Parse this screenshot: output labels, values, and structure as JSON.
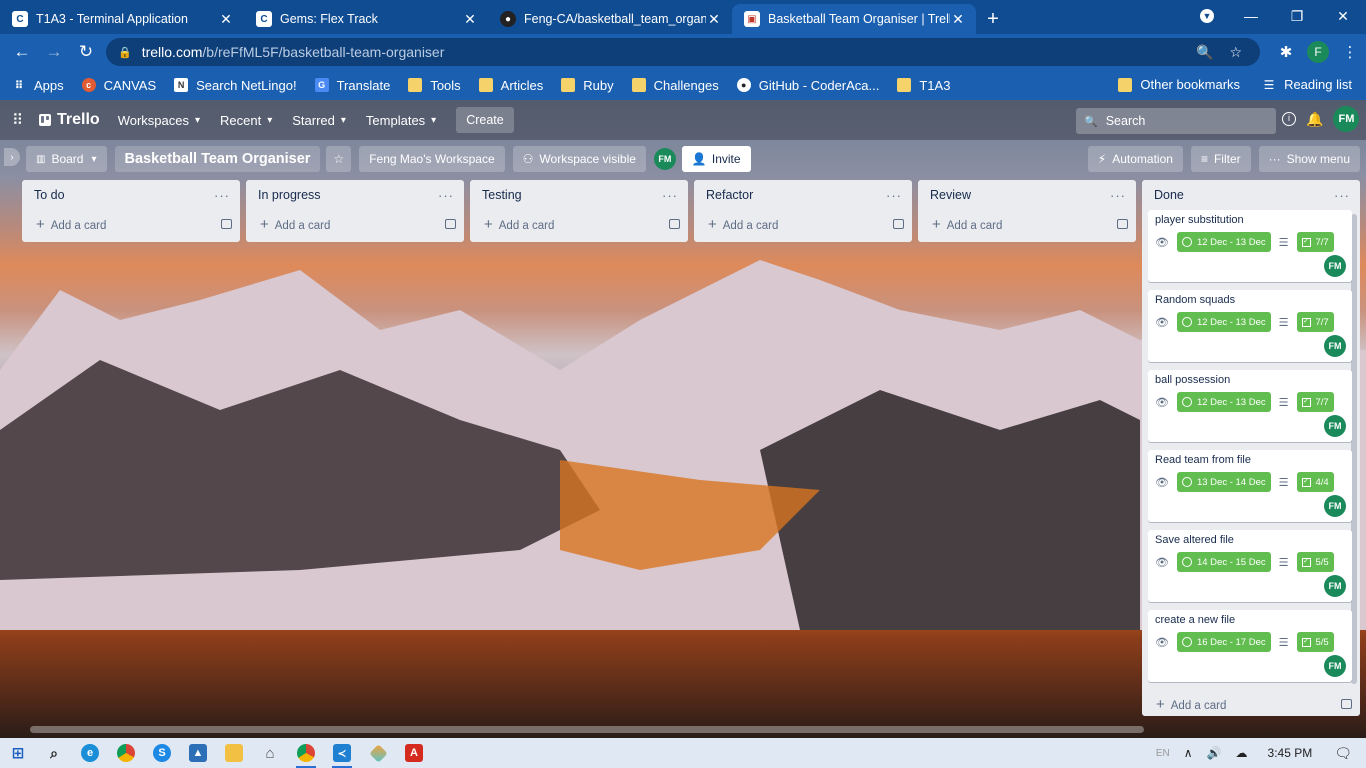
{
  "browser": {
    "tabs": [
      {
        "title": "T1A3 - Terminal Application",
        "icon": "canvas-icon",
        "active": false
      },
      {
        "title": "Gems: Flex Track",
        "icon": "canvas-icon",
        "active": false
      },
      {
        "title": "Feng-CA/basketball_team_organiser",
        "icon": "github-icon",
        "active": false
      },
      {
        "title": "Basketball Team Organiser | Trello",
        "icon": "trello-icon",
        "active": true
      }
    ],
    "url_host": "trello.com",
    "url_path": "/b/reFfML5F/basketball-team-organiser",
    "profile_initial": "F",
    "bookmarks": [
      {
        "label": "Apps",
        "icon": "apps-grid-icon"
      },
      {
        "label": "CANVAS",
        "icon": "canvas-icon"
      },
      {
        "label": "Search NetLingo!",
        "icon": "netlingo-icon"
      },
      {
        "label": "Translate",
        "icon": "translate-icon"
      },
      {
        "label": "Tools",
        "icon": "folder-icon"
      },
      {
        "label": "Articles",
        "icon": "folder-icon"
      },
      {
        "label": "Ruby",
        "icon": "folder-icon"
      },
      {
        "label": "Challenges",
        "icon": "folder-icon"
      },
      {
        "label": "GitHub - CoderAca...",
        "icon": "github-icon"
      },
      {
        "label": "T1A3",
        "icon": "folder-icon"
      }
    ],
    "other_bookmarks": "Other bookmarks",
    "reading_list": "Reading list"
  },
  "trello": {
    "logo": "Trello",
    "nav": [
      "Workspaces",
      "Recent",
      "Starred",
      "Templates"
    ],
    "create": "Create",
    "search_placeholder": "Search",
    "user_initials": "FM",
    "board": {
      "view": "Board",
      "title": "Basketball Team Organiser",
      "workspace": "Feng Mao's Workspace",
      "visibility": "Workspace visible",
      "invite": "Invite",
      "automation": "Automation",
      "filter": "Filter",
      "show_menu": "Show menu"
    },
    "add_card": "Add a card",
    "lists": [
      {
        "title": "To do"
      },
      {
        "title": "In progress"
      },
      {
        "title": "Testing"
      },
      {
        "title": "Refactor"
      },
      {
        "title": "Review"
      }
    ],
    "done": {
      "title": "Done",
      "cards": [
        {
          "title": "player substitution",
          "due": "12 Dec - 13 Dec",
          "checklist": "7/7",
          "member": "FM"
        },
        {
          "title": "Random squads",
          "due": "12 Dec - 13 Dec",
          "checklist": "7/7",
          "member": "FM"
        },
        {
          "title": "ball possession",
          "due": "12 Dec - 13 Dec",
          "checklist": "7/7",
          "member": "FM"
        },
        {
          "title": "Read team from file",
          "due": "13 Dec - 14 Dec",
          "checklist": "4/4",
          "member": "FM"
        },
        {
          "title": "Save altered file",
          "due": "14 Dec - 15 Dec",
          "checklist": "5/5",
          "member": "FM"
        },
        {
          "title": "create a new file",
          "due": "16 Dec - 17 Dec",
          "checklist": "5/5",
          "member": "FM"
        }
      ]
    }
  },
  "taskbar": {
    "apps": [
      "start-icon",
      "search-icon",
      "edge-icon",
      "chrome-icon",
      "skype-icon",
      "photos-icon",
      "file-explorer-icon",
      "home-icon",
      "chrome-icon",
      "vscode-icon",
      "git-icon",
      "pdf-icon"
    ],
    "language": "EN",
    "time": "3:45 PM"
  },
  "colors": {
    "chrome_frame": "#0f4c92",
    "chrome_toolbar": "#1b5fb0",
    "trello_green": "#61bd4f",
    "avatar_green": "#1b8a5a",
    "list_bg": "#ebecf0"
  }
}
